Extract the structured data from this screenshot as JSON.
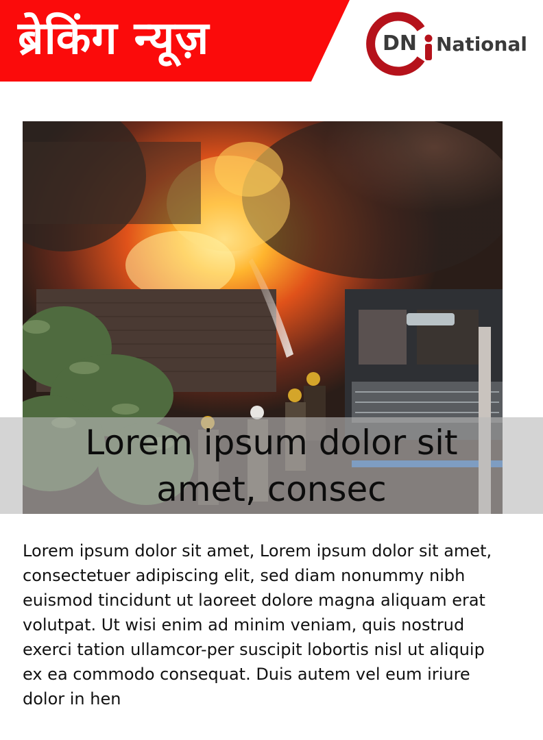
{
  "banner": {
    "title": "ब्रेकिंग न्यूज़",
    "color": "#fb0b0b"
  },
  "logo": {
    "letters": "DN",
    "name": "National",
    "ring_color": "#b5121b",
    "icon": "dn-national-logo-icon"
  },
  "photo": {
    "icon": "fire-scene-photo"
  },
  "headline": "Lorem ipsum dolor sit amet, consec",
  "body": "Lorem ipsum dolor sit amet, Lorem ipsum dolor sit amet, consectetuer adipiscing elit, sed diam nonummy nibh euismod tincidunt ut laoreet dolore magna aliquam erat volutpat. Ut wisi enim ad minim veniam, quis nostrud exerci tation ullamcor-per suscipit lobortis nisl ut aliquip ex ea commodo consequat. Duis autem vel eum iriure dolor in hen"
}
